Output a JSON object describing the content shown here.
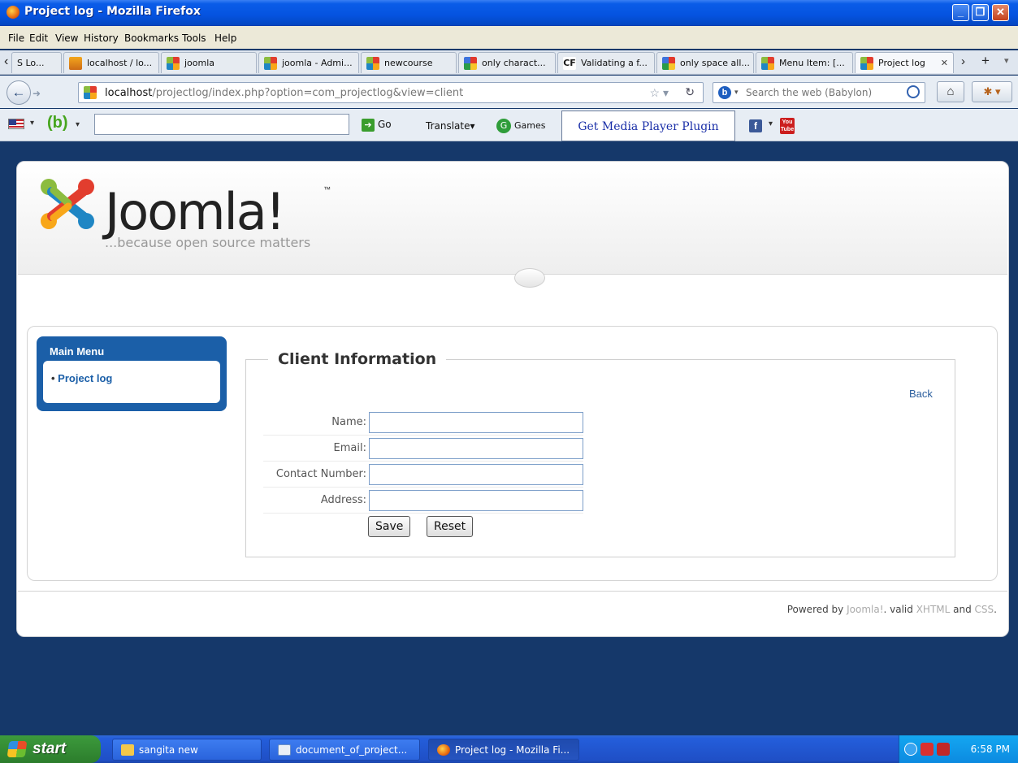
{
  "window": {
    "title": "Project log - Mozilla Firefox"
  },
  "menubar": [
    "File",
    "Edit",
    "View",
    "History",
    "Bookmarks",
    "Tools",
    "Help"
  ],
  "tabs": [
    {
      "label": "S Lo..."
    },
    {
      "label": "localhost / lo..."
    },
    {
      "label": "joomla"
    },
    {
      "label": "joomla - Admi..."
    },
    {
      "label": "newcourse"
    },
    {
      "label": "only charact..."
    },
    {
      "label": "Validating a f..."
    },
    {
      "label": "only space all..."
    },
    {
      "label": "Menu Item: [..."
    },
    {
      "label": "Project log"
    }
  ],
  "navbar": {
    "url_host": "localhost",
    "url_path": "/projectlog/index.php?option=com_projectlog&view=client",
    "search_placeholder": "Search the web (Babylon)"
  },
  "toolbar2": {
    "go_label": "Go",
    "translate_label": "Translate",
    "games_label": "Games",
    "media_plugin_label": "Get Media Player Plugin"
  },
  "site": {
    "logo_text": "Joomla!",
    "logo_tm": "™",
    "tagline": "...because open source matters"
  },
  "main_menu": {
    "title": "Main Menu",
    "items": [
      "Project log"
    ]
  },
  "form": {
    "legend": "Client Information",
    "back_label": "Back",
    "fields": [
      {
        "label": "Name:",
        "value": ""
      },
      {
        "label": "Email:",
        "value": ""
      },
      {
        "label": "Contact Number:",
        "value": ""
      },
      {
        "label": "Address:",
        "value": ""
      }
    ],
    "save_label": "Save",
    "reset_label": "Reset"
  },
  "footer": {
    "powered_by": "Powered by ",
    "joomla_link": "Joomla!",
    "valid": ". valid ",
    "xhtml_link": "XHTML",
    "and": " and ",
    "css_link": "CSS",
    "end": "."
  },
  "taskbar": {
    "start_label": "start",
    "tasks": [
      "sangita new",
      "document_of_project...",
      "Project log - Mozilla Fi..."
    ],
    "clock": "6:58 PM"
  }
}
